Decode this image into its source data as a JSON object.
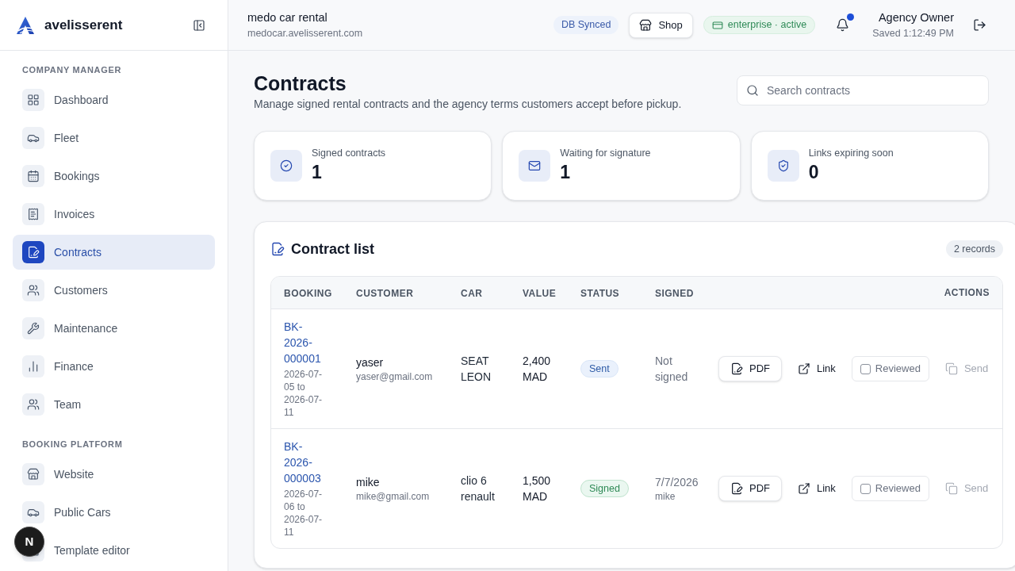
{
  "sidebar": {
    "brand": "avelisserent",
    "sections": [
      {
        "title": "COMPANY MANAGER",
        "items": [
          {
            "label": "Dashboard",
            "selected": false
          },
          {
            "label": "Fleet",
            "selected": false
          },
          {
            "label": "Bookings",
            "selected": false
          },
          {
            "label": "Invoices",
            "selected": false
          },
          {
            "label": "Contracts",
            "selected": true
          },
          {
            "label": "Customers",
            "selected": false
          },
          {
            "label": "Maintenance",
            "selected": false
          },
          {
            "label": "Finance",
            "selected": false
          },
          {
            "label": "Team",
            "selected": false
          }
        ]
      },
      {
        "title": "BOOKING PLATFORM",
        "items": [
          {
            "label": "Website",
            "selected": false
          },
          {
            "label": "Public Cars",
            "selected": false
          },
          {
            "label": "Template editor",
            "selected": false
          }
        ]
      }
    ]
  },
  "dev_badge": {
    "label": "N"
  },
  "topbar": {
    "workspace": "medo car rental",
    "domain": "medocar.avelisserent.com",
    "sync_badge": "DB Synced",
    "shop_button": "Shop",
    "plan_badge": "enterprise · active",
    "notifications": {
      "unread": true
    },
    "user": {
      "name": "Agency Owner",
      "saved": "Saved 1:12:49 PM"
    }
  },
  "page": {
    "title": "Contracts",
    "subtitle": "Manage signed rental contracts and the agency terms customers accept before pickup.",
    "search": {
      "placeholder": "Search contracts"
    }
  },
  "stats": [
    {
      "label": "Signed contracts",
      "value": "1"
    },
    {
      "label": "Waiting for signature",
      "value": "1"
    },
    {
      "label": "Links expiring soon",
      "value": "0"
    }
  ],
  "contract_list": {
    "title": "Contract list",
    "count": "2 records",
    "columns": [
      "BOOKING",
      "CUSTOMER",
      "CAR",
      "VALUE",
      "STATUS",
      "SIGNED",
      "ACTIONS"
    ],
    "rows": [
      {
        "booking": "BK-2026-000001",
        "dates": "2026-07-05 to 2026-07-11",
        "customer": "yaser",
        "email": "yaser@gmail.com",
        "car": "SEAT LEON",
        "value": "2,400 MAD",
        "status": {
          "label": "Sent",
          "kind": "sent"
        },
        "signed": {
          "text": "Not signed"
        },
        "actions": {
          "pdf": "PDF",
          "link": "Link",
          "reviewed": {
            "label": "Reviewed",
            "checked": false
          },
          "send": {
            "label": "Send",
            "disabled": true
          }
        }
      },
      {
        "booking": "BK-2026-000003",
        "dates": "2026-07-06 to 2026-07-11",
        "customer": "mike",
        "email": "mike@gmail.com",
        "car": "clio 6 renault",
        "value": "1,500 MAD",
        "status": {
          "label": "Signed",
          "kind": "signed"
        },
        "signed": {
          "text": "7/7/2026",
          "by": "mike"
        },
        "actions": {
          "pdf": "PDF",
          "link": "Link",
          "reviewed": {
            "label": "Reviewed",
            "checked": false
          },
          "send": {
            "label": "Send",
            "disabled": true
          }
        }
      }
    ]
  }
}
